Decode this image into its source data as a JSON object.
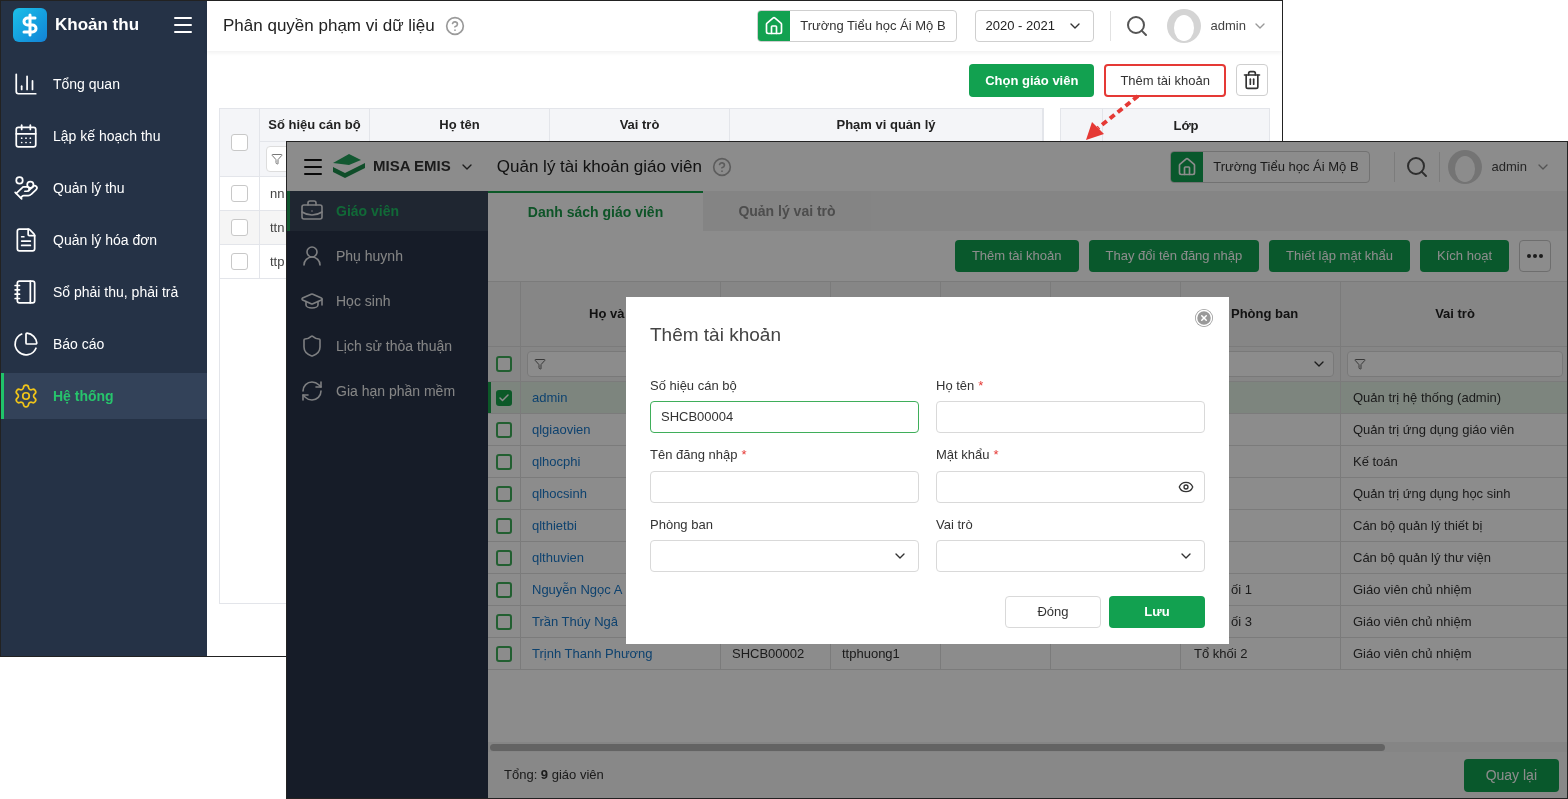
{
  "back_window": {
    "sidebar": {
      "app_name": "Khoản thu",
      "items": [
        {
          "label": "Tổng quan",
          "selected": false
        },
        {
          "label": "Lập kế hoạch thu",
          "selected": false
        },
        {
          "label": "Quản lý thu",
          "selected": false
        },
        {
          "label": "Quản lý hóa đơn",
          "selected": false
        },
        {
          "label": "Sổ phải thu, phải trả",
          "selected": false
        },
        {
          "label": "Báo cáo",
          "selected": false
        },
        {
          "label": "Hệ thống",
          "selected": true
        }
      ]
    },
    "header": {
      "title": "Phân quyền phạm vi dữ liệu",
      "school": "Trường Tiểu học Ái Mộ B",
      "year": "2020 - 2021",
      "user": "admin"
    },
    "toolbar": [
      {
        "label": "Chọn giáo viên",
        "kind": "primary",
        "highlighted": false
      },
      {
        "label": "Thêm tài khoản",
        "kind": "outlined",
        "highlighted": true
      }
    ],
    "table": {
      "columns": [
        "Số hiệu cán bộ",
        "Họ tên",
        "Vai trò",
        "Phạm vi quản lý"
      ],
      "header_checked": false,
      "rows": [
        {
          "code": "nn",
          "checked": false
        },
        {
          "code": "ttn",
          "checked": false
        },
        {
          "code": "ttp",
          "checked": false
        }
      ]
    },
    "side_table": {
      "columns": [
        "Lớp"
      ]
    }
  },
  "front_window": {
    "header": {
      "brand": "MISA EMIS",
      "title": "Quản lý tài khoản giáo viên",
      "school": "Trường Tiểu học Ái Mộ B",
      "user": "admin"
    },
    "sidebar": [
      {
        "label": "Giáo viên",
        "selected": true
      },
      {
        "label": "Phụ huynh",
        "selected": false
      },
      {
        "label": "Học sinh",
        "selected": false
      },
      {
        "label": "Lịch sử thỏa thuận",
        "selected": false
      },
      {
        "label": "Gia hạn phần mềm",
        "selected": false
      }
    ],
    "tabs": [
      {
        "label": "Danh sách giáo viên",
        "selected": true
      },
      {
        "label": "Quản lý vai trò",
        "selected": false
      }
    ],
    "toolbar": [
      "Thêm tài khoản",
      "Thay đổi tên đăng nhập",
      "Thiết lập mật khẩu",
      "Kích hoạt"
    ],
    "table": {
      "columns": {
        "name": "Họ và",
        "department": "Phòng ban",
        "role": "Vai trò"
      },
      "header_checked": false,
      "rows": [
        {
          "name": "admin",
          "role": "Quản trị hệ thống (admin)",
          "checked": true,
          "selected": true
        },
        {
          "name": "qlgiaovien",
          "role": "Quản trị ứng dụng giáo viên",
          "checked": false,
          "selected": false
        },
        {
          "name": "qlhocphi",
          "role": "Kế toán",
          "checked": false,
          "selected": false
        },
        {
          "name": "qlhocsinh",
          "role": "Quản trị ứng dụng học sinh",
          "checked": false,
          "selected": false
        },
        {
          "name": "qlthietbi",
          "role": "Cán bộ quản lý thiết bị",
          "checked": false,
          "selected": false
        },
        {
          "name": "qlthuvien",
          "role": "Cán bộ quản lý thư viện",
          "checked": false,
          "selected": false
        },
        {
          "name": "Nguyễn Ngọc A",
          "department": "ối 1",
          "role": "Giáo viên chủ nhiệm",
          "checked": false,
          "selected": false
        },
        {
          "name": "Trần Thúy Ngâ",
          "department": "ối 3",
          "role": "Giáo viên chủ nhiệm",
          "checked": false,
          "selected": false
        },
        {
          "name": "Trịnh Thanh Phương",
          "code": "SHCB00002",
          "username": "ttphuong1",
          "department": "Tổ khối 2",
          "role": "Giáo viên chủ nhiệm",
          "checked": false,
          "selected": false
        }
      ]
    },
    "footer": {
      "total": "Tổng: **9** giáo viên",
      "back_button": "Quay lại"
    }
  },
  "dialog": {
    "title": "Thêm tài khoản",
    "fields": [
      {
        "label": "Số hiệu cán bộ",
        "kind": "text",
        "value": "SHCB00004",
        "focused": true
      },
      {
        "label": "Họ tên",
        "kind": "text",
        "required_mark": "*",
        "focused": false
      },
      {
        "label": "Tên đăng nhập",
        "kind": "text",
        "required_mark": "*",
        "focused": false
      },
      {
        "label": "Mật khẩu",
        "kind": "password",
        "required_mark": "*",
        "focused": false
      },
      {
        "label": "Phòng ban",
        "kind": "select",
        "focused": false
      },
      {
        "label": "Vai trò",
        "kind": "select",
        "focused": false
      }
    ],
    "buttons": [
      {
        "label": "Đóng",
        "kind": "secondary"
      },
      {
        "label": "Lưu",
        "kind": "primary"
      }
    ]
  }
}
